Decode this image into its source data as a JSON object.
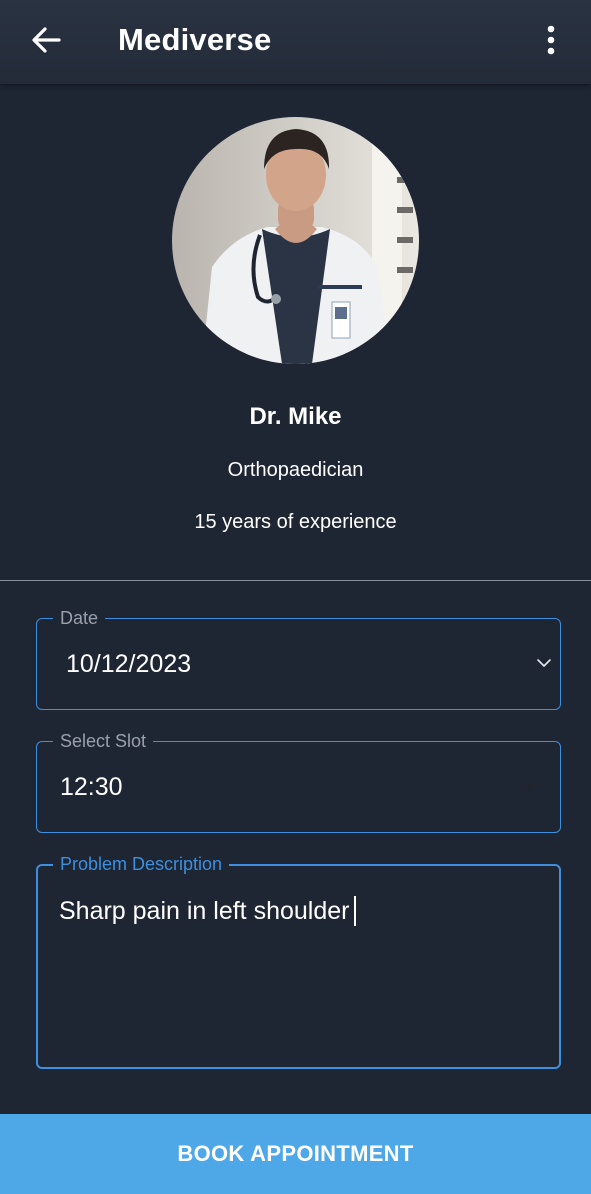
{
  "app_bar": {
    "title": "Mediverse",
    "back_icon": "arrow-left-icon",
    "menu_icon": "more-vert-icon"
  },
  "doctor": {
    "photo": "doctor-portrait-photo",
    "name": "Dr. Mike",
    "specialty": "Orthopaedician",
    "experience": "15 years of experience"
  },
  "form": {
    "date": {
      "label": "Date",
      "value": "10/12/2023",
      "icon": "chevron-down-icon"
    },
    "slot": {
      "label": "Select Slot",
      "value": "12:30",
      "icon": "dropdown-arrow-icon"
    },
    "description": {
      "label": "Problem Description",
      "value": "Sharp pain in left shoulder",
      "focused": true
    }
  },
  "book_button": {
    "label": "BOOK APPOINTMENT"
  },
  "colors": {
    "background": "#1e2533",
    "app_bar": "#262e3d",
    "accent": "#3d8fe0",
    "button": "#4ea8e8",
    "label_muted": "#9aa1ac",
    "divider": "#8b919b"
  }
}
